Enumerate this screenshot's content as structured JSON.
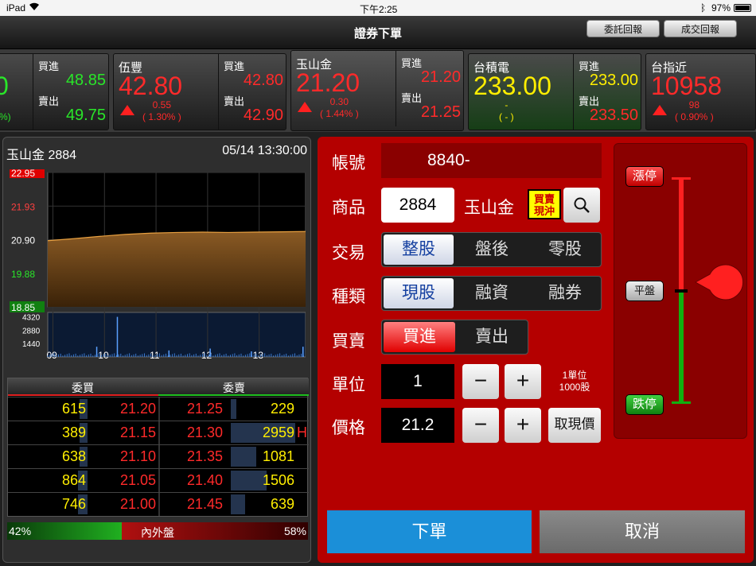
{
  "status_bar": {
    "device": "iPad",
    "time": "下午2:25",
    "battery": "97%"
  },
  "nav": {
    "title": "證券下單",
    "btn_orders": "委託回報",
    "btn_fills": "成交回報"
  },
  "tickers": [
    {
      "name": "",
      "price": "0",
      "chg1": "",
      "chg2": "%)",
      "buy_label": "買進",
      "buy": "48.85",
      "sell_label": "賣出",
      "sell": "49.75"
    },
    {
      "name": "伍豐",
      "price": "42.80",
      "chg1": "0.55",
      "chg2": "( 1.30% )",
      "buy_label": "買進",
      "buy": "42.80",
      "sell_label": "賣出",
      "sell": "42.90"
    },
    {
      "name": "玉山金",
      "price": "21.20",
      "chg1": "0.30",
      "chg2": "( 1.44% )",
      "buy_label": "買進",
      "buy": "21.20",
      "sell_label": "賣出",
      "sell": "21.25"
    },
    {
      "name": "台積電",
      "price": "233.00",
      "chg1": "-",
      "chg2": "( - )",
      "buy_label": "買進",
      "buy": "233.00",
      "sell_label": "賣出",
      "sell": "233.50"
    },
    {
      "name": "台指近",
      "price": "10958",
      "chg1": "98",
      "chg2": "( 0.90% )"
    }
  ],
  "quote": {
    "title": "玉山金 2884",
    "datetime": "05/14 13:30:00"
  },
  "chart_data": {
    "type": "area",
    "y_ticks": [
      "22.95",
      "21.93",
      "20.90",
      "19.88",
      "18.85"
    ],
    "x_ticks": [
      "09",
      "10",
      "11",
      "12",
      "13"
    ],
    "volume_ticks": [
      "4320",
      "2880",
      "1440"
    ],
    "ylim": [
      18.85,
      22.95
    ],
    "x": [
      0,
      0.1,
      0.2,
      0.3,
      0.4,
      0.5,
      0.6,
      0.7,
      0.8,
      0.9,
      1.0
    ],
    "price": [
      20.87,
      20.93,
      21.0,
      21.06,
      21.1,
      21.12,
      21.13,
      21.12,
      21.13,
      21.14,
      21.15
    ],
    "volume_spikes": [
      [
        0.27,
        4320
      ],
      [
        0.19,
        1100
      ],
      [
        0.47,
        700
      ],
      [
        0.63,
        900
      ],
      [
        0.79,
        600
      ],
      [
        0.99,
        1100
      ]
    ]
  },
  "orderbook": {
    "head_bid": "委買",
    "head_ask": "委賣",
    "rows": [
      {
        "bid_qty": "615",
        "bid_px": "21.20",
        "ask_px": "21.25",
        "ask_qty": "229",
        "bid_fill": 0.1,
        "ask_fill": 0.08,
        "mark": ""
      },
      {
        "bid_qty": "389",
        "bid_px": "21.15",
        "ask_px": "21.30",
        "ask_qty": "2959",
        "bid_fill": 0.1,
        "ask_fill": 0.9,
        "mark": "H"
      },
      {
        "bid_qty": "638",
        "bid_px": "21.10",
        "ask_px": "21.35",
        "ask_qty": "1081",
        "bid_fill": 0.1,
        "ask_fill": 0.35,
        "mark": ""
      },
      {
        "bid_qty": "864",
        "bid_px": "21.05",
        "ask_px": "21.40",
        "ask_qty": "1506",
        "bid_fill": 0.12,
        "ask_fill": 0.5,
        "mark": ""
      },
      {
        "bid_qty": "746",
        "bid_px": "21.00",
        "ask_px": "21.45",
        "ask_qty": "639",
        "bid_fill": 0.12,
        "ask_fill": 0.2,
        "mark": ""
      }
    ],
    "in_pct": "42%",
    "out_pct": "58%",
    "label": "內外盤",
    "in_fraction": 0.42
  },
  "form": {
    "account_label": "帳號",
    "account": "8840-",
    "product_label": "商品",
    "product_code": "2884",
    "product_name": "玉山金",
    "daytrade_badge_1": "買賣",
    "daytrade_badge_2": "現沖",
    "trade_label": "交易",
    "trade_opts": [
      "整股",
      "盤後",
      "零股"
    ],
    "type_label": "種類",
    "type_opts": [
      "現股",
      "融資",
      "融券"
    ],
    "side_label": "買賣",
    "side_buy": "買進",
    "side_sell": "賣出",
    "unit_label": "單位",
    "unit": "1",
    "unit_note_1": "1單位",
    "unit_note_2": "1000股",
    "price_label": "價格",
    "price": "21.2",
    "minus": "−",
    "plus": "+",
    "get_price": "取現價",
    "limit_up": "漲停",
    "flat": "平盤",
    "limit_down": "跌停",
    "submit": "下單",
    "cancel": "取消"
  },
  "colors": {
    "up": "#ff2a2a",
    "down": "#29e629",
    "accent": "#b40000",
    "submit": "#1b8fd8"
  }
}
